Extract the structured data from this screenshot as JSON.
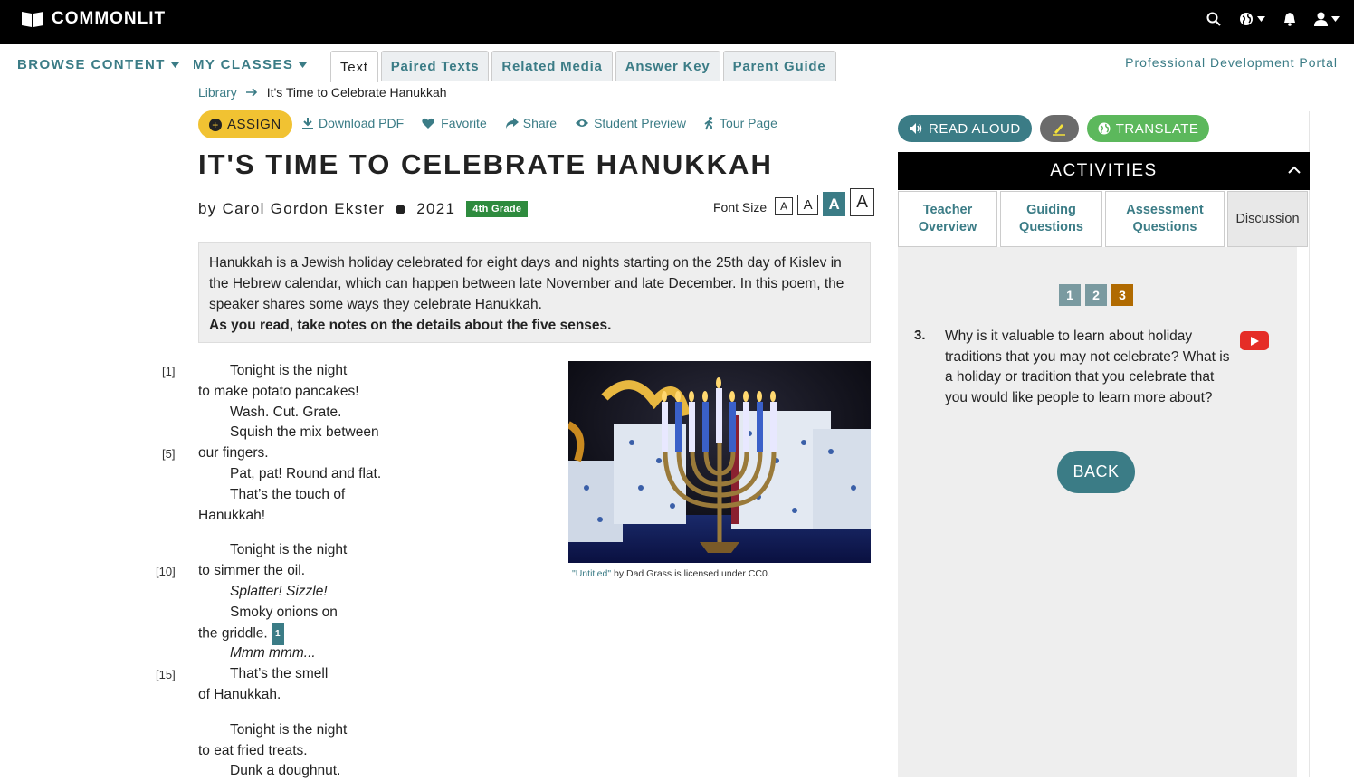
{
  "brand": {
    "name": "COMMONLIT"
  },
  "topnav": {
    "icons": [
      "search-icon",
      "globe-icon",
      "bell-icon",
      "user-icon"
    ]
  },
  "nav": {
    "browse": "BROWSE CONTENT",
    "classes": "MY CLASSES",
    "tabs": [
      "Text",
      "Paired Texts",
      "Related Media",
      "Answer Key",
      "Parent Guide"
    ],
    "active_tab": "Text",
    "pd_portal": "Professional Development Portal"
  },
  "breadcrumb": {
    "root": "Library",
    "current": "It's Time to Celebrate Hanukkah"
  },
  "actions": {
    "assign": "ASSIGN",
    "download": "Download PDF",
    "favorite": "Favorite",
    "share": "Share",
    "preview": "Student Preview",
    "tour": "Tour Page"
  },
  "text": {
    "title": "IT'S TIME TO CELEBRATE HANUKKAH",
    "author": "by Carol Gordon Ekster",
    "year": "2021",
    "grade": "4th Grade",
    "font_size_label": "Font Size",
    "font_sizes": [
      "A",
      "A",
      "A",
      "A"
    ],
    "intro": "Hanukkah is a Jewish holiday celebrated for eight days and nights starting on the 25th day of Kislev in the Hebrew calendar, which can happen between late November and late December. In this poem, the speaker shares some ways they celebrate Hanukkah.",
    "instruction": "As you read, take notes on the details about the five senses."
  },
  "poem": {
    "line_numbers": [
      "[1]",
      "[5]",
      "[10]",
      "[15]"
    ],
    "lines": [
      "Tonight is the night",
      "to make potato pancakes!",
      "Wash. Cut. Grate.",
      "Squish the mix between",
      "our fingers.",
      "Pat, pat! Round and flat.",
      "That’s the touch of",
      "Hanukkah!",
      "Tonight is the night",
      "to simmer the oil.",
      "Splatter! Sizzle!",
      "Smoky onions on",
      "the griddle.",
      "Mmm mmm...",
      "That’s the smell",
      "of Hanukkah.",
      "Tonight is the night",
      "to eat fried treats.",
      "Dunk a doughnut."
    ],
    "footnote": "1"
  },
  "image": {
    "caption_link": "\"Untitled\"",
    "caption_rest": " by Dad Grass is licensed under CC0."
  },
  "panel": {
    "read_aloud": "READ ALOUD",
    "translate": "TRANSLATE",
    "activities": "ACTIVITIES",
    "tabs": [
      "Teacher Overview",
      "Guiding Questions",
      "Assessment Questions",
      "Discussion"
    ],
    "active_tab": "Discussion",
    "question_pages": [
      "1",
      "2",
      "3"
    ],
    "current_page": "3",
    "question_number": "3.",
    "question": "Why is it valuable to learn about holiday traditions that you may not celebrate? What is a holiday or tradition that you celebrate that you would like people to learn more about?",
    "back": "BACK"
  },
  "colors": {
    "accent": "#3b7c86",
    "assign": "#f1c232",
    "current_page": "#b06a00",
    "translate": "#5cb85c",
    "grade": "#2e8b3e"
  }
}
